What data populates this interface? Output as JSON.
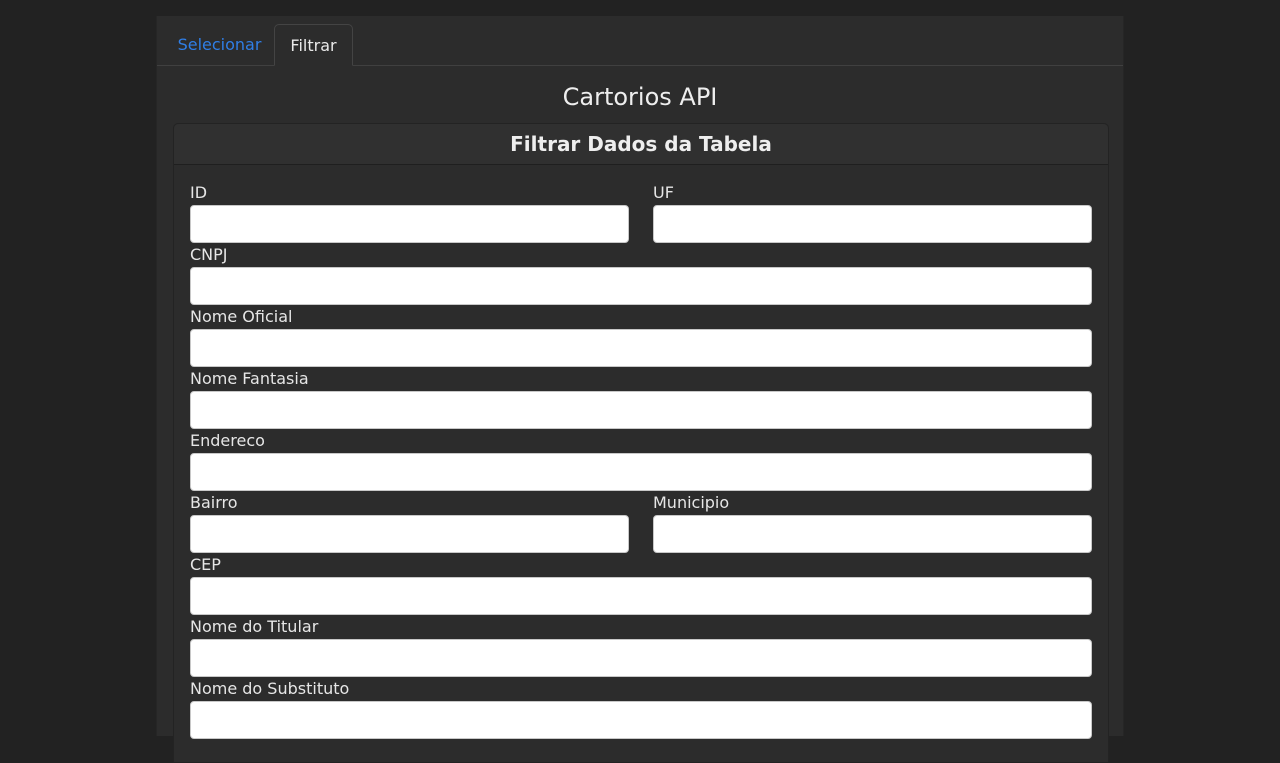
{
  "tabs": [
    {
      "label": "Selecionar"
    },
    {
      "label": "Filtrar"
    }
  ],
  "page_title": "Cartorios API",
  "card": {
    "title": "Filtrar Dados da Tabela"
  },
  "fields": {
    "id": {
      "label": "ID",
      "value": ""
    },
    "uf": {
      "label": "UF",
      "value": ""
    },
    "cnpj": {
      "label": "CNPJ",
      "value": ""
    },
    "nome_oficial": {
      "label": "Nome Oficial",
      "value": ""
    },
    "nome_fantasia": {
      "label": "Nome Fantasia",
      "value": ""
    },
    "endereco": {
      "label": "Endereco",
      "value": ""
    },
    "bairro": {
      "label": "Bairro",
      "value": ""
    },
    "municipio": {
      "label": "Municipio",
      "value": ""
    },
    "cep": {
      "label": "CEP",
      "value": ""
    },
    "nome_titular": {
      "label": "Nome do Titular",
      "value": ""
    },
    "nome_substituto": {
      "label": "Nome do Substituto",
      "value": ""
    }
  },
  "colors": {
    "background": "#222222",
    "panel": "#2c2c2c",
    "active_link": "#2f7ee6",
    "text": "#e6e6e6"
  }
}
